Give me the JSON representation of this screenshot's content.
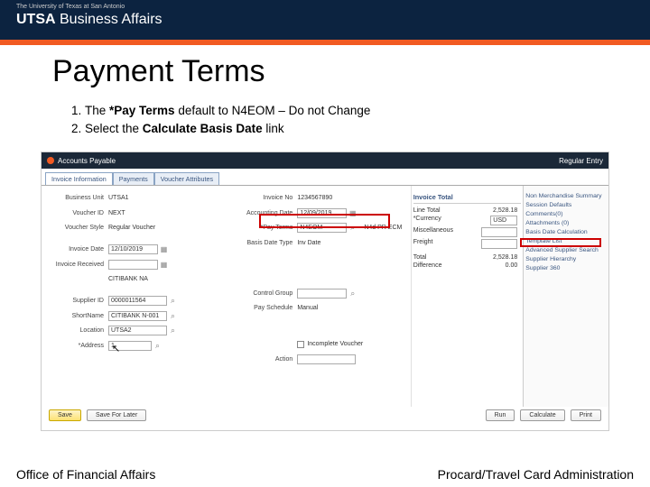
{
  "header": {
    "university": "The University of Texas at San Antonio",
    "brand_bold": "UTSA",
    "brand_rest": " Business Affairs"
  },
  "page_title": "Payment Terms",
  "instructions": [
    {
      "pre": "The ",
      "bold": "*Pay Terms",
      "post": " default to N4EOM – Do not Change"
    },
    {
      "pre": "Select the ",
      "bold": "Calculate Basis Date",
      "post": " link"
    }
  ],
  "screenshot": {
    "app_title": "Accounts Payable",
    "mode": "Regular Entry",
    "tabs": [
      "Invoice Information",
      "Payments",
      "Voucher Attributes"
    ],
    "left_fields": {
      "business_unit_lbl": "Business Unit",
      "business_unit": "UTSA1",
      "voucher_id_lbl": "Voucher ID",
      "voucher_id": "NEXT",
      "voucher_style_lbl": "Voucher Style",
      "voucher_style": "Regular Voucher",
      "invoice_date_lbl": "Invoice Date",
      "invoice_date": "12/10/2019",
      "invoice_received_lbl": "Invoice Received",
      "invoice_received": "",
      "bank_name": "CITIBANK NA",
      "supplier_id_lbl": "Supplier ID",
      "supplier_id": "0000011564",
      "short_name_lbl": "ShortName",
      "short_name": "CITIBANK N-001",
      "location_lbl": "Location",
      "location": "UTSA2",
      "address_lbl": "*Address",
      "address": "1"
    },
    "mid_fields": {
      "invoice_no_lbl": "Invoice No",
      "invoice_no": "1234567890",
      "accounting_date_lbl": "Accounting Date",
      "accounting_date": "12/09/2019",
      "pay_terms_lbl": "*Pay Terms",
      "pay_terms": "N4EOM",
      "pay_terms_aux": "N4d PR ECM",
      "basis_date_lbl": "Basis Date Type",
      "basis_date": "Inv Date",
      "control_group_lbl": "Control Group",
      "control_group": "",
      "pay_schedule_lbl": "Pay Schedule",
      "pay_schedule": "Manual",
      "incomplete_lbl": "Incomplete Voucher",
      "action_lbl": "Action"
    },
    "invoice_total": {
      "header": "Invoice Total",
      "line_total_lbl": "Line Total",
      "line_total": "2,528.18",
      "currency_lbl": "*Currency",
      "currency": "USD",
      "misc_lbl": "Miscellaneous",
      "misc": "",
      "freight_lbl": "Freight",
      "freight": "",
      "total_lbl": "Total",
      "total": "2,528.18",
      "difference_lbl": "Difference",
      "difference": "0.00"
    },
    "far_links": [
      "Non Merchandise Summary",
      "Session Defaults",
      "Comments(0)",
      "Attachments (0)",
      "Basis Date Calculation",
      "Template List",
      "Advanced Supplier Search",
      "Supplier Hierarchy",
      "Supplier 360"
    ],
    "buttons": {
      "save": "Save",
      "save_later": "Save For Later",
      "run": "Run",
      "calculate": "Calculate",
      "print": "Print"
    }
  },
  "footer": {
    "left": "Office of Financial Affairs",
    "right": "Procard/Travel Card Administration"
  }
}
